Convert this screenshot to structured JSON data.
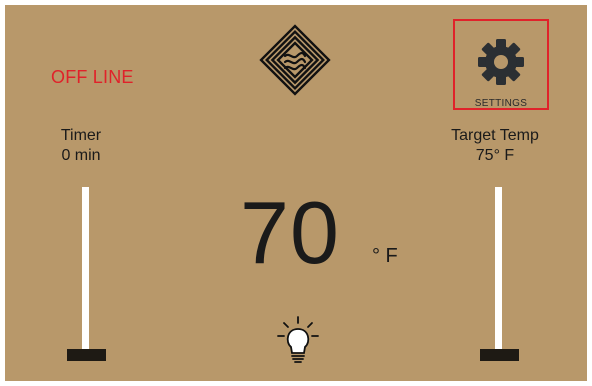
{
  "status": {
    "text": "OFF LINE",
    "color": "#e0222a"
  },
  "settings": {
    "label": "SETTINGS",
    "icon": "gear-icon"
  },
  "timer": {
    "title": "Timer",
    "value": "0 min",
    "level": 0
  },
  "target_temp": {
    "title": "Target Temp",
    "value": "75° F",
    "level": 0
  },
  "current_temp": {
    "value": "70",
    "unit": "° F"
  },
  "light": {
    "icon": "lightbulb-icon"
  },
  "colors": {
    "background": "#b8986a",
    "text": "#1a1a1a",
    "track": "#ffffff",
    "handle": "#1e1a14",
    "highlight": "#e0222a"
  }
}
